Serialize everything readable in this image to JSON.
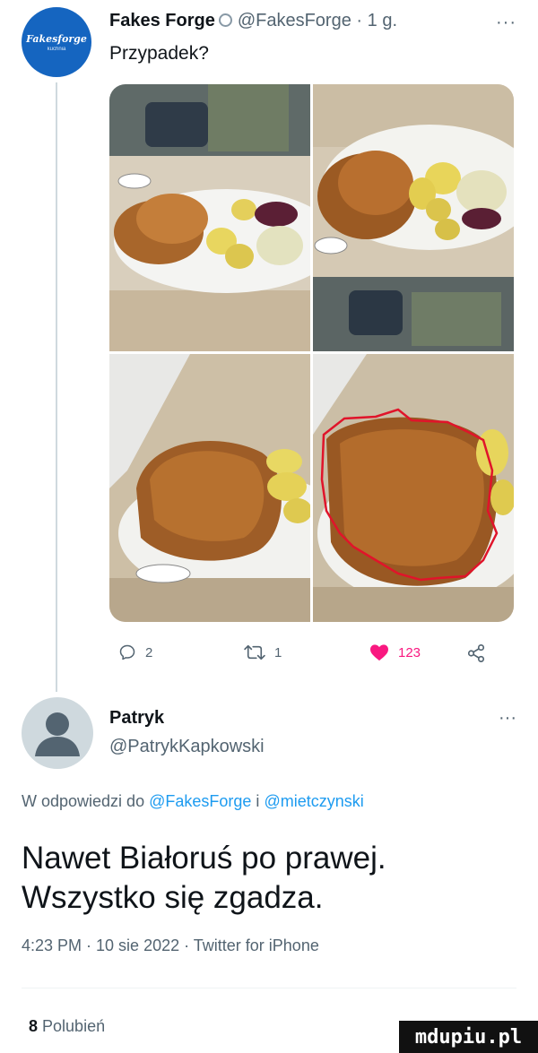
{
  "tweet": {
    "avatar_logo_text": "Fakesforge",
    "avatar_logo_sub": "kuchnia",
    "author_name": "Fakes Forge",
    "author_handle": "@FakesForge",
    "separator": "·",
    "time": "1 g.",
    "more": "···",
    "text": "Przypadek?",
    "icons": [
      "verified-icon",
      "reply-icon",
      "retweet-icon",
      "heart-icon",
      "share-icon"
    ],
    "stats": {
      "replies": "2",
      "retweets": "1",
      "likes": "123"
    },
    "colors": {
      "like": "#f91880",
      "muted": "#536471",
      "link": "#1d9bf0",
      "avatar_bg": "#1565c0"
    }
  },
  "reply": {
    "author_name": "Patryk",
    "author_handle": "@PatrykKapkowski",
    "more": "···",
    "replying_prefix": "W odpowiedzi do",
    "mention1": "@FakesForge",
    "conj": "i",
    "mention2": "@mietczynski",
    "line1": "Nawet Białoruś po prawej.",
    "line2": "Wszystko się zgadza.",
    "timestamp": "4:23 PM · 10 sie 2022 · Twitter for iPhone",
    "likes_count": "8",
    "likes_label": "Polubień"
  },
  "watermark": "mdupiu.pl"
}
